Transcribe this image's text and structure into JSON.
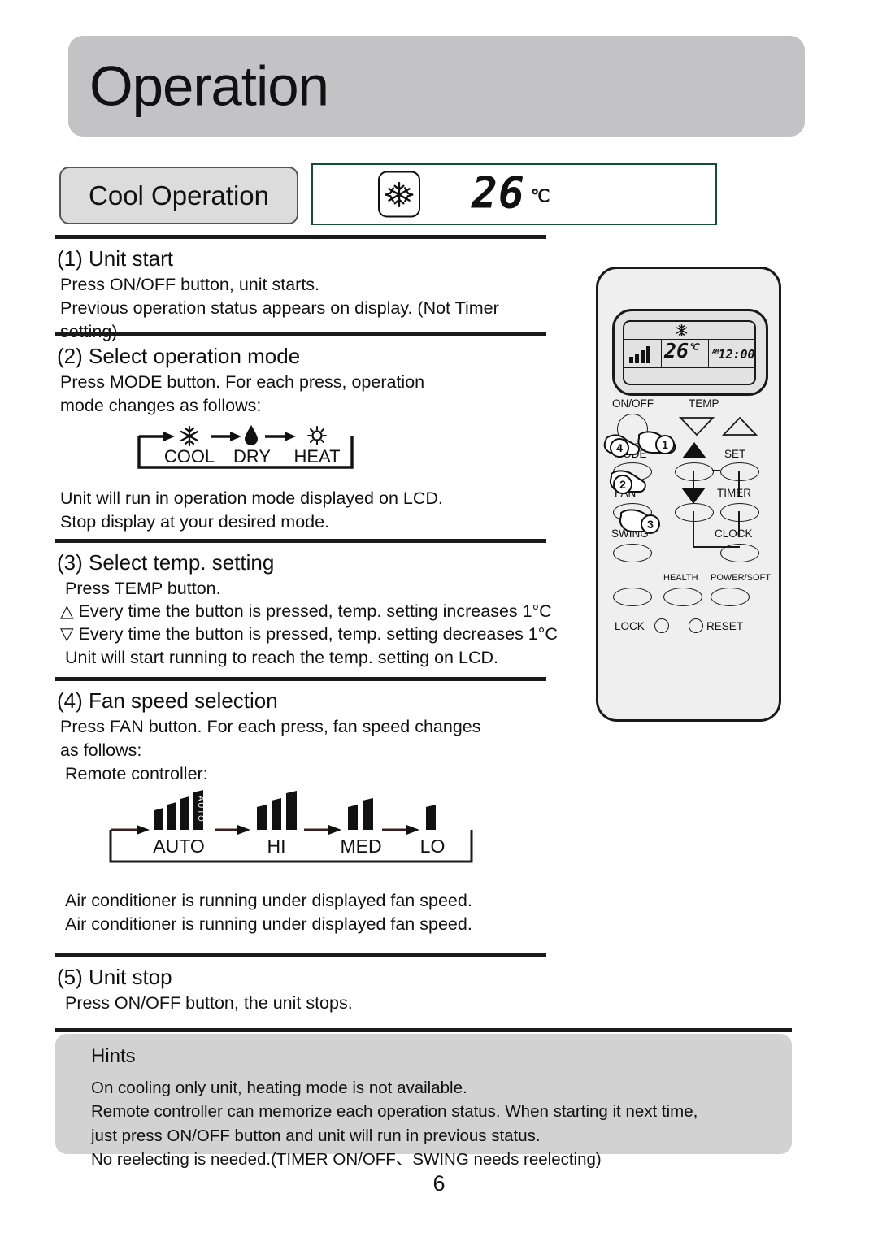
{
  "header": {
    "title": "Operation"
  },
  "section_label": {
    "pill_text": "Cool Operation"
  },
  "lcd_strip": {
    "mode_icon": "snowflake-icon",
    "temperature": "26",
    "unit": "℃"
  },
  "steps": [
    {
      "heading": "(1) Unit start",
      "lines": [
        "Press ON/OFF button, unit starts.",
        "Previous operation status appears on display. (Not Timer setting)"
      ]
    },
    {
      "heading": "(2) Select operation mode",
      "lines": [
        "Press MODE button. For each press, operation",
        "mode changes as follows:"
      ],
      "after_lines": [
        "Unit will run in operation mode displayed on LCD.",
        "Stop display at your desired mode."
      ]
    },
    {
      "heading": "(3) Select temp. setting",
      "lines": [
        "Press TEMP button.",
        "△ Every time the button is pressed, temp. setting increases 1°C",
        "▽ Every time the button is pressed, temp. setting decreases 1°C",
        "Unit will start running to reach the temp. setting on LCD."
      ]
    },
    {
      "heading": "(4) Fan speed selection",
      "lines": [
        "Press FAN button. For each press, fan speed changes",
        "as follows:",
        "Remote controller:"
      ],
      "after_lines": [
        "Air conditioner is running under displayed fan speed.",
        "Air conditioner is running under displayed fan speed."
      ]
    },
    {
      "heading": "(5) Unit stop",
      "lines": [
        "Press ON/OFF button, the unit stops."
      ]
    }
  ],
  "mode_cycle": {
    "items": [
      {
        "icon": "snowflake-icon",
        "label": "COOL"
      },
      {
        "icon": "water-drop-icon",
        "label": "DRY"
      },
      {
        "icon": "sun-icon",
        "label": "HEAT"
      }
    ]
  },
  "fan_cycle": {
    "items": [
      {
        "label": "AUTO",
        "bars": 3,
        "auto_text": "AUTO"
      },
      {
        "label": "HI",
        "bars": 3
      },
      {
        "label": "MED",
        "bars": 2
      },
      {
        "label": "LO",
        "bars": 1
      }
    ]
  },
  "remote": {
    "display": {
      "mode_icon": "snowflake-icon",
      "fan_bars": 4,
      "temperature": "26",
      "unit": "℃",
      "am_label": "AM",
      "clock": "12:00"
    },
    "labels": {
      "on_off": "ON/OFF",
      "temp": "TEMP",
      "mode": "MODE",
      "set": "SET",
      "fan": "FAN",
      "timer": "TIMER",
      "swing": "SWING",
      "clock": "CLOCK",
      "health": "HEALTH",
      "power_soft": "POWER/SOFT",
      "lock": "LOCK",
      "reset": "RESET"
    },
    "callouts": [
      "1",
      "2",
      "3",
      "4"
    ]
  },
  "hints": {
    "title": "Hints",
    "lines": [
      "On cooling only unit, heating mode is not available.",
      "Remote controller can memorize each operation status. When starting it next time,",
      "just press ON/OFF button and unit will run in previous status.",
      "No reelecting is needed.(TIMER ON/OFF、SWING  needs reelecting)"
    ]
  },
  "footer": {
    "page_number": "6"
  },
  "colors": {
    "banner_gray": "#c3c3c5",
    "pill_gray": "#dcdcdc",
    "lcd_border_green": "#14502f",
    "hints_gray": "#d2d2d2",
    "ink": "#111111"
  }
}
